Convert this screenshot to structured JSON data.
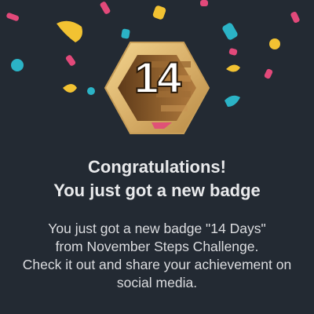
{
  "badge": {
    "number": "14",
    "icon": "hexagon-badge-icon",
    "colors": {
      "frame": "#d9b06a",
      "inner": "#7a5228",
      "text": "#ffffff"
    }
  },
  "heading": {
    "line1": "Congratulations!",
    "line2": "You just got a new badge"
  },
  "message": {
    "line1": "You just got a new badge \"14 Days\"",
    "line2": "from November Steps Challenge.",
    "line3": "Check it out and share your achievement on",
    "line4": "social media."
  },
  "colors": {
    "background": "#232a33",
    "confetti_pink": "#e2497a",
    "confetti_yellow": "#f2c232",
    "confetti_teal": "#2bb3c6"
  }
}
